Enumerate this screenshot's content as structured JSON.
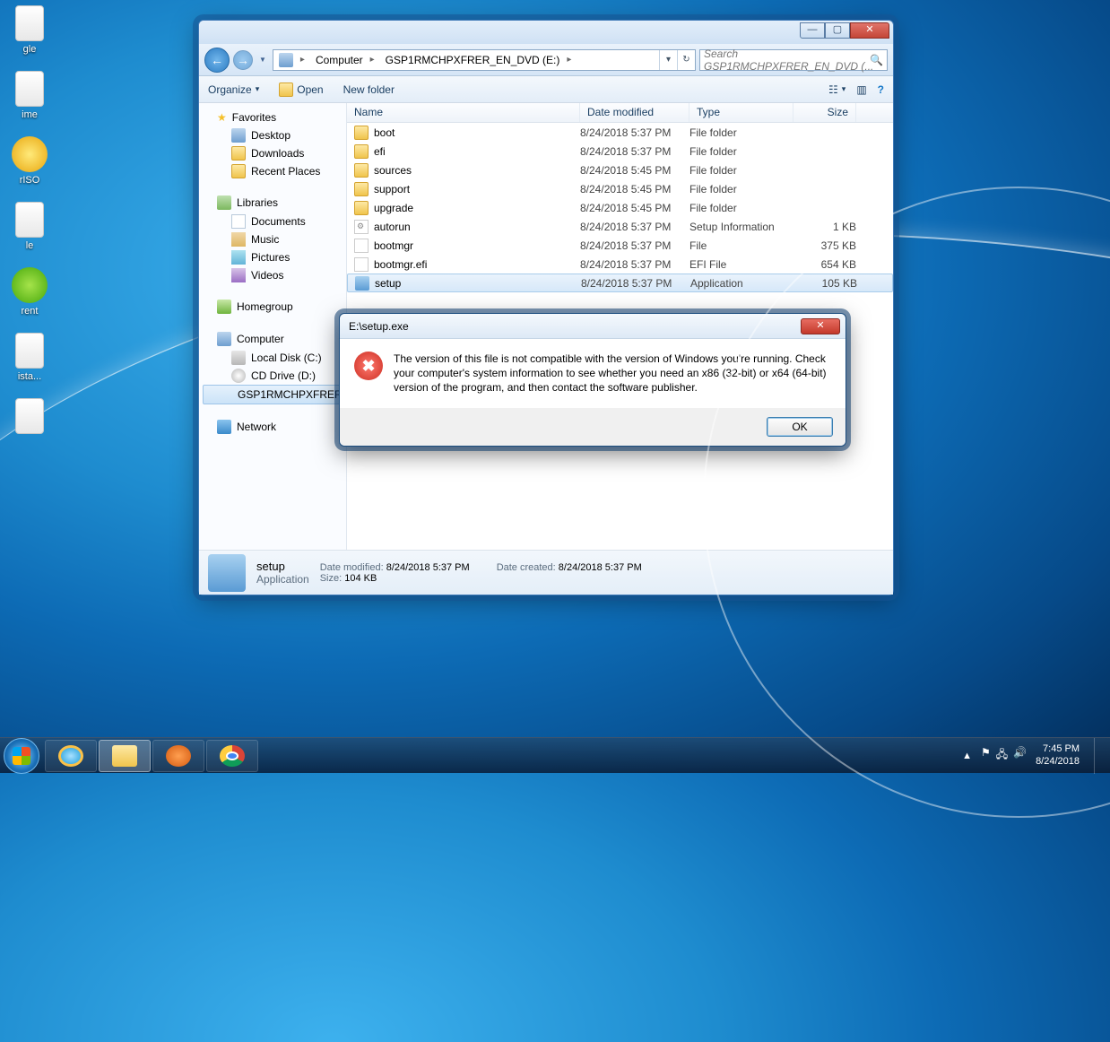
{
  "desktop": {
    "icons": [
      {
        "name": "gle",
        "glyph": "file"
      },
      {
        "name": "ime",
        "glyph": "file"
      },
      {
        "name": "rISO",
        "glyph": "circle-yellow"
      },
      {
        "name": "le",
        "glyph": "file"
      },
      {
        "name": "μTorrent",
        "glyph": "circle-green",
        "shortname": "rent"
      },
      {
        "name": "ista...",
        "glyph": "file"
      },
      {
        "name": "",
        "glyph": "file"
      }
    ]
  },
  "window": {
    "controls": {
      "min": "—",
      "max": "▢",
      "close": "✕"
    },
    "breadcrumb": [
      "Computer",
      "GSP1RMCHPXFRER_EN_DVD (E:)"
    ],
    "address_refresh": "↻",
    "address_drop": "▾",
    "search_placeholder": "Search GSP1RMCHPXFRER_EN_DVD (...",
    "toolbar": {
      "organize": "Organize",
      "open": "Open",
      "new_folder": "New folder",
      "view": "☷",
      "preview": "▥",
      "help": "?"
    },
    "sidebar": {
      "favorites": {
        "label": "Favorites",
        "items": [
          "Desktop",
          "Downloads",
          "Recent Places"
        ]
      },
      "libraries": {
        "label": "Libraries",
        "items": [
          "Documents",
          "Music",
          "Pictures",
          "Videos"
        ]
      },
      "homegroup": "Homegroup",
      "computer": {
        "label": "Computer",
        "items": [
          "Local Disk (C:)",
          "CD Drive (D:)",
          "GSP1RMCHPXFRER_..."
        ]
      },
      "network": "Network"
    },
    "columns": {
      "name": "Name",
      "date": "Date modified",
      "type": "Type",
      "size": "Size"
    },
    "rows": [
      {
        "name": "boot",
        "date": "8/24/2018 5:37 PM",
        "type": "File folder",
        "size": "",
        "icon": "folder"
      },
      {
        "name": "efi",
        "date": "8/24/2018 5:37 PM",
        "type": "File folder",
        "size": "",
        "icon": "folder"
      },
      {
        "name": "sources",
        "date": "8/24/2018 5:45 PM",
        "type": "File folder",
        "size": "",
        "icon": "folder"
      },
      {
        "name": "support",
        "date": "8/24/2018 5:45 PM",
        "type": "File folder",
        "size": "",
        "icon": "folder"
      },
      {
        "name": "upgrade",
        "date": "8/24/2018 5:45 PM",
        "type": "File folder",
        "size": "",
        "icon": "folder"
      },
      {
        "name": "autorun",
        "date": "8/24/2018 5:37 PM",
        "type": "Setup Information",
        "size": "1 KB",
        "icon": "inf"
      },
      {
        "name": "bootmgr",
        "date": "8/24/2018 5:37 PM",
        "type": "File",
        "size": "375 KB",
        "icon": "file"
      },
      {
        "name": "bootmgr.efi",
        "date": "8/24/2018 5:37 PM",
        "type": "EFI File",
        "size": "654 KB",
        "icon": "file"
      },
      {
        "name": "setup",
        "date": "8/24/2018 5:37 PM",
        "type": "Application",
        "size": "105 KB",
        "icon": "app",
        "selected": true
      }
    ],
    "details": {
      "name": "setup",
      "type": "Application",
      "l_mod": "Date modified:",
      "v_mod": "8/24/2018 5:37 PM",
      "l_size": "Size:",
      "v_size": "104 KB",
      "l_created": "Date created:",
      "v_created": "8/24/2018 5:37 PM"
    }
  },
  "dialog": {
    "title": "E:\\setup.exe",
    "message": "The version of this file is not compatible with the version of Windows you're running. Check your computer's system information to see whether you need an x86 (32-bit) or x64 (64-bit) version of the program, and then contact the software publisher.",
    "ok": "OK",
    "close": "✕"
  },
  "taskbar": {
    "hidden_tray": "▲",
    "clock_time": "7:45 PM",
    "clock_date": "8/24/2018"
  }
}
